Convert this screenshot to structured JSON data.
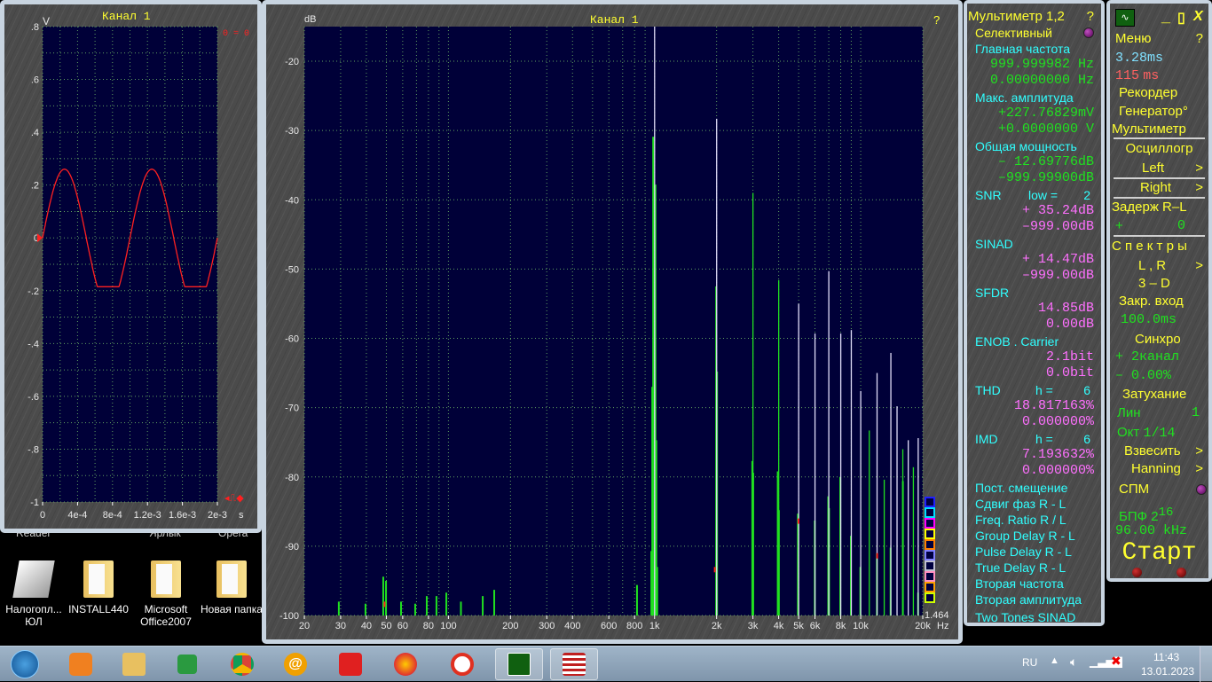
{
  "desktop": {
    "partial_labels": [
      "Reader",
      "Ярлык",
      "Opera"
    ],
    "icons": [
      {
        "label1": "Налогопл...",
        "label2": "ЮЛ"
      },
      {
        "label1": "INSTALL440",
        "label2": ""
      },
      {
        "label1": "Microsoft",
        "label2": "Office2007"
      },
      {
        "label1": "Новая папка",
        "label2": ""
      }
    ]
  },
  "osc": {
    "title": "Канал 1",
    "y_unit": "V",
    "x_unit": "s",
    "marker_top": "0 = 0",
    "colors": {
      "trace": "#ff2020",
      "plot_bg": "#000038",
      "grid": "#60a060"
    }
  },
  "spectrum": {
    "title": "Канал 1",
    "help": "?",
    "y_unit": "dB",
    "x_unit": "Hz",
    "readout": "1.464",
    "swatches": [
      "#2020ff",
      "#00e0ff",
      "#ff00ff",
      "#ffff00",
      "#ff8000",
      "#8080ff",
      "#c0c0d0",
      "#ff90c0",
      "#ffa000",
      "#d0ff00"
    ]
  },
  "chart_data": [
    {
      "type": "line",
      "title": "Канал 1",
      "xlabel": "s",
      "ylabel": "V",
      "xlim": [
        0,
        0.002
      ],
      "ylim": [
        -1,
        0.8
      ],
      "xticks": [
        0,
        0.0004,
        0.0008,
        0.0012,
        0.0016,
        0.002
      ],
      "xtick_labels": [
        "0",
        "4e-4",
        "8e-4",
        "1.2e-3",
        "1.6e-3",
        "2e-3"
      ],
      "yticks": [
        0.8,
        0.6,
        0.4,
        0.2,
        0,
        -0.2,
        -0.4,
        -0.6,
        -0.8,
        -1
      ],
      "ytick_labels": [
        ".8",
        ".6",
        ".4",
        ".2",
        "0",
        "-.2",
        "-.4",
        "-.6",
        "-.8",
        "-1"
      ],
      "grid": true,
      "signal": {
        "frequency_hz": 1000,
        "amplitude_v": 0.26,
        "clip_low_v": -0.185
      }
    },
    {
      "type": "bar",
      "title": "Канал 1",
      "xlabel": "Hz",
      "ylabel": "dB",
      "xscale": "log",
      "xlim": [
        20,
        20000
      ],
      "ylim": [
        -100,
        -15
      ],
      "xticks": [
        20,
        30,
        40,
        50,
        60,
        80,
        100,
        200,
        300,
        400,
        600,
        800,
        1000,
        2000,
        3000,
        4000,
        5000,
        6000,
        8000,
        10000,
        20000
      ],
      "xtick_labels": [
        "20",
        "30",
        "40",
        "50",
        "60",
        "80",
        "100",
        "200",
        "300",
        "400",
        "600",
        "800",
        "1k",
        "2k",
        "3k",
        "4k",
        "5k",
        "6k",
        "8k",
        "10k",
        "20k"
      ],
      "yticks": [
        -20,
        -30,
        -40,
        -50,
        -60,
        -70,
        -80,
        -90,
        -100
      ],
      "ytick_labels": [
        "-20",
        "-30",
        "-40",
        "-50",
        "-60",
        "-70",
        "-80",
        "-90",
        "-100"
      ],
      "grid": true,
      "series": [
        {
          "name": "harmonics",
          "color_main": "#e0dcf8",
          "color_alt": "#20e020",
          "points": [
            [
              1000,
              -15,
              "w"
            ],
            [
              2000,
              -28.3,
              "w"
            ],
            [
              3000,
              -39,
              "g"
            ],
            [
              4000,
              -51.6,
              "g"
            ],
            [
              5000,
              -55,
              "w"
            ],
            [
              6000,
              -59.3,
              "w"
            ],
            [
              7000,
              -50.3,
              "w"
            ],
            [
              8000,
              -59.3,
              "w"
            ],
            [
              9000,
              -58.8,
              "w"
            ],
            [
              10000,
              -67.6,
              "w"
            ],
            [
              11000,
              -73.3,
              "g"
            ],
            [
              12000,
              -65,
              "w"
            ],
            [
              13000,
              -80.4,
              "g"
            ],
            [
              14000,
              -62.1,
              "w"
            ],
            [
              15000,
              -69.8,
              "w"
            ],
            [
              16000,
              -76,
              "g"
            ],
            [
              17000,
              -74.7,
              "w"
            ],
            [
              18000,
              -78.6,
              "g"
            ],
            [
              19000,
              -74.4,
              "w"
            ]
          ]
        },
        {
          "name": "secondary",
          "color": "#20e020",
          "points": [
            [
              985,
              -30.9
            ],
            [
              1010,
              -37.8
            ],
            [
              975,
              -67
            ],
            [
              1020,
              -74.7
            ],
            [
              1030,
              -93
            ],
            [
              965,
              -90.7
            ],
            [
              1990,
              -52.5
            ],
            [
              2010,
              -64.8
            ],
            [
              2980,
              -77.7
            ],
            [
              3010,
              -79.4
            ],
            [
              3960,
              -79.2
            ],
            [
              4010,
              -84.8
            ],
            [
              4960,
              -85.3
            ],
            [
              5990,
              -86.3
            ],
            [
              6960,
              -82.8
            ],
            [
              7020,
              -84.5
            ],
            [
              7960,
              -80
            ],
            [
              8960,
              -88.5
            ],
            [
              9960,
              -93
            ],
            [
              11990,
              -91
            ],
            [
              13960,
              -90.2
            ],
            [
              16020,
              -80.6
            ],
            [
              18980,
              -96.7
            ],
            [
              29.4,
              -98
            ],
            [
              39.6,
              -98.3
            ],
            [
              48.3,
              -94.4
            ],
            [
              49.8,
              -95
            ],
            [
              58.9,
              -98
            ],
            [
              69,
              -98.3
            ],
            [
              78.5,
              -97.2
            ],
            [
              87.5,
              -97.2
            ],
            [
              97.7,
              -96.7
            ],
            [
              115,
              -98
            ],
            [
              146.7,
              -97.2
            ],
            [
              166.8,
              -96.3
            ],
            [
              822,
              -95.6
            ]
          ]
        },
        {
          "name": "red markers",
          "color": "#ff2020",
          "points": [
            [
              49,
              -98
            ],
            [
              4990,
              -86
            ],
            [
              12020,
              -91
            ],
            [
              1960,
              -93
            ]
          ]
        }
      ]
    }
  ],
  "multimeter": {
    "title": "Мультиметр 1,2",
    "help": "?",
    "mode": "Селективный",
    "main_freq_label": "Главная частота",
    "main_freq_1": "999.999982",
    "main_freq_2": "0.00000000",
    "hz": "Hz",
    "max_amp_label": "Макс. амплитуда",
    "max_amp_1": "+227.76829",
    "max_amp_1_unit": "mV",
    "max_amp_2": "+0.0000000",
    "max_amp_2_unit": "V",
    "power_label": "Общая мощность",
    "power_1": "– 12.69776",
    "power_2": "–999.99900",
    "db": "dB",
    "snr_label": "SNR",
    "snr_low": "low =",
    "snr_low_val": "2",
    "snr_1": "+ 35.24",
    "snr_2": "–999.00",
    "sinad_label": "SINAD",
    "sinad_1": "+ 14.47",
    "sinad_2": "–999.00",
    "sfdr_label": "SFDR",
    "sfdr_1": "14.85",
    "sfdr_2": "0.00",
    "enob_label": "ENOB . Carrier",
    "enob_1": "2.1",
    "enob_2": "0.0",
    "bit": "bit",
    "thd_label": "THD",
    "thd_h": "h =",
    "thd_h_val": "6",
    "thd_1": "18.817163",
    "thd_2": "0.000000",
    "pct": "%",
    "imd_label": "IMD",
    "imd_h": "h =",
    "imd_h_val": "6",
    "imd_1": "7.193632",
    "imd_2": "0.000000",
    "extras": [
      "Пост. смещение",
      "Сдвиг фаз R - L",
      "Freq. Ratio  R / L",
      "Group Delay R - L",
      "Pulse Delay R - L",
      "True Delay R - L",
      "Вторая частота",
      "Вторая амплитуда",
      "Two Tones SINAD"
    ]
  },
  "control": {
    "min": "_",
    "max": "▯",
    "close": "X",
    "menu": "Меню",
    "help": "?",
    "t1": "3.28",
    "t1_unit": "ms",
    "t2": "115",
    "t2_unit": "ms",
    "recorder": "Рекордер",
    "generator": "Генератор°",
    "multimeter": "Мультиметр",
    "osc": "Осциллогр",
    "left": "Left",
    "right": "Right",
    "arrow": ">",
    "delay": "Задерж  R–L",
    "delay_sign": "+",
    "delay_val": "0",
    "spectra": "С п е к т р ы",
    "lr": "L , R",
    "three_d": "3 – D",
    "closed_input": "Закр.  вход",
    "closed_val": "100.0",
    "closed_unit": "ms",
    "sync": "Синхро",
    "sync_1": "+ 2",
    "sync_1b": "канал",
    "sync_2": "– 0.00",
    "sync_2b": "%",
    "atten": "Затухание",
    "lin": "Лин",
    "lin_val": "1",
    "oct": "Окт",
    "oct_val": "1/14",
    "weight": "Взвесить",
    "window": "Hanning",
    "psd": "СПМ",
    "fft": "БПФ   2",
    "fft_exp": "16",
    "rate": "96.00",
    "rate_unit": "kHz",
    "start": "Старт"
  },
  "tray": {
    "lang": "RU",
    "time": "11:43",
    "date": "13.01.2023"
  }
}
